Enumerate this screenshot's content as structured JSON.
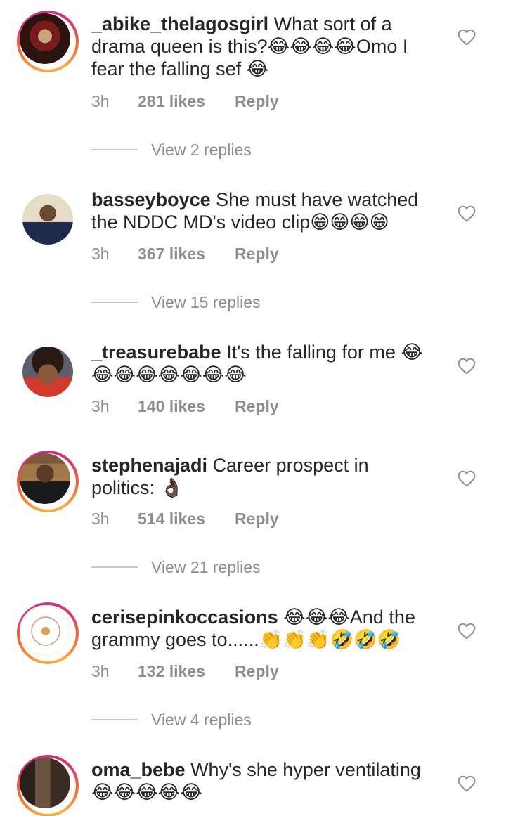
{
  "comments": [
    {
      "username": "_abike_thelagosgirl",
      "lines": [
        "What sort of a",
        "drama queen is this?😂😂😂😂Omo I",
        "fear the falling sef 😂"
      ],
      "time": "3h",
      "likes": "281 likes",
      "reply": "Reply",
      "view_replies": "View 2 replies"
    },
    {
      "username": "basseyboyce",
      "lines": [
        "She must have watched",
        "the NDDC MD's video clip😁😁😁😁"
      ],
      "time": "3h",
      "likes": "367 likes",
      "reply": "Reply",
      "view_replies": "View 15 replies"
    },
    {
      "username": "_treasurebabe",
      "lines": [
        "It's the falling for me 😂",
        "😂😂😂😂😂😂😂"
      ],
      "time": "3h",
      "likes": "140 likes",
      "reply": "Reply",
      "view_replies": ""
    },
    {
      "username": "stephenajadi",
      "lines": [
        "Career prospect in",
        "politics: 👌🏿"
      ],
      "time": "3h",
      "likes": "514 likes",
      "reply": "Reply",
      "view_replies": "View 21 replies"
    },
    {
      "username": "cerisepinkoccasions",
      "lines": [
        "😂😂😂And the",
        "grammy goes to......👏👏👏🤣🤣🤣"
      ],
      "time": "3h",
      "likes": "132 likes",
      "reply": "Reply",
      "view_replies": "View 4 replies"
    },
    {
      "username": "oma_bebe",
      "lines": [
        "Why's she hyper ventilating",
        "😂😂😂😂😂"
      ],
      "time": "",
      "likes": "",
      "reply": "",
      "view_replies": ""
    }
  ],
  "icons": {
    "like": "heart-outline-icon"
  },
  "colors": {
    "text": "#262626",
    "meta": "#8e8e8e",
    "ring_start": "#f9a53b",
    "ring_end": "#c13584"
  }
}
